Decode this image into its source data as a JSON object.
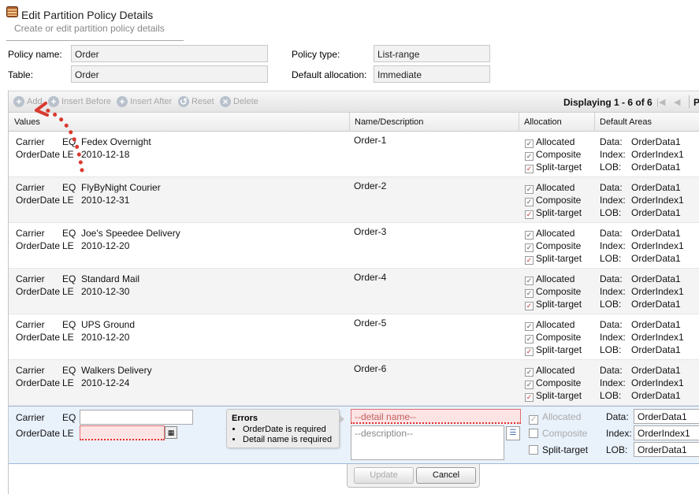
{
  "header": {
    "title": "Edit Partition Policy Details",
    "subtitle": "Create or edit partition policy details"
  },
  "form": {
    "policy_name_label": "Policy name:",
    "policy_name_value": "Order",
    "table_label": "Table:",
    "table_value": "Order",
    "policy_type_label": "Policy type:",
    "policy_type_value": "List-range",
    "default_allocation_label": "Default allocation:",
    "default_allocation_value": "Immediate"
  },
  "toolbar": {
    "add": "Add",
    "insert_before": "Insert Before",
    "insert_after": "Insert After",
    "reset": "Reset",
    "delete": "Delete",
    "paging_text": "Displaying 1 - 6 of 6",
    "paging_cut": "P"
  },
  "columns": {
    "values": "Values",
    "name": "Name/Description",
    "allocation": "Allocation",
    "default_areas": "Default Areas"
  },
  "rows": [
    {
      "carrier": "Fedex Overnight",
      "date": "2010-12-18",
      "name": "Order-1"
    },
    {
      "carrier": "FlyByNight Courier",
      "date": "2010-12-31",
      "name": "Order-2"
    },
    {
      "carrier": "Joe's Speedee Delivery",
      "date": "2010-12-20",
      "name": "Order-3"
    },
    {
      "carrier": "Standard Mail",
      "date": "2010-12-30",
      "name": "Order-4"
    },
    {
      "carrier": "UPS Ground",
      "date": "2010-12-20",
      "name": "Order-5"
    },
    {
      "carrier": "Walkers Delivery",
      "date": "2010-12-24",
      "name": "Order-6"
    }
  ],
  "row_labels": {
    "carrier": "Carrier",
    "eq": "EQ",
    "orderdate": "OrderDate",
    "le": "LE",
    "allocated": "Allocated",
    "composite": "Composite",
    "split_target": "Split-target",
    "data": "Data:",
    "index": "Index:",
    "lob": "LOB:",
    "data_val": "OrderData1",
    "index_val": "OrderIndex1",
    "lob_val": "OrderData1"
  },
  "edit_row": {
    "carrier_label": "Carrier",
    "eq": "EQ",
    "orderdate_label": "OrderDate",
    "le": "LE",
    "carrier_value": "",
    "date_value": "",
    "detail_placeholder": "--detail name--",
    "description_placeholder": "--description--",
    "allocated": "Allocated",
    "composite": "Composite",
    "split_target": "Split-target",
    "data_label": "Data:",
    "index_label": "Index:",
    "lob_label": "LOB:",
    "data_value": "OrderData1",
    "index_value": "OrderIndex1",
    "lob_value": "OrderData1"
  },
  "errors": {
    "title": "Errors",
    "items": [
      "OrderDate is required",
      "Detail name is required"
    ]
  },
  "buttons": {
    "update": "Update",
    "cancel": "Cancel"
  }
}
